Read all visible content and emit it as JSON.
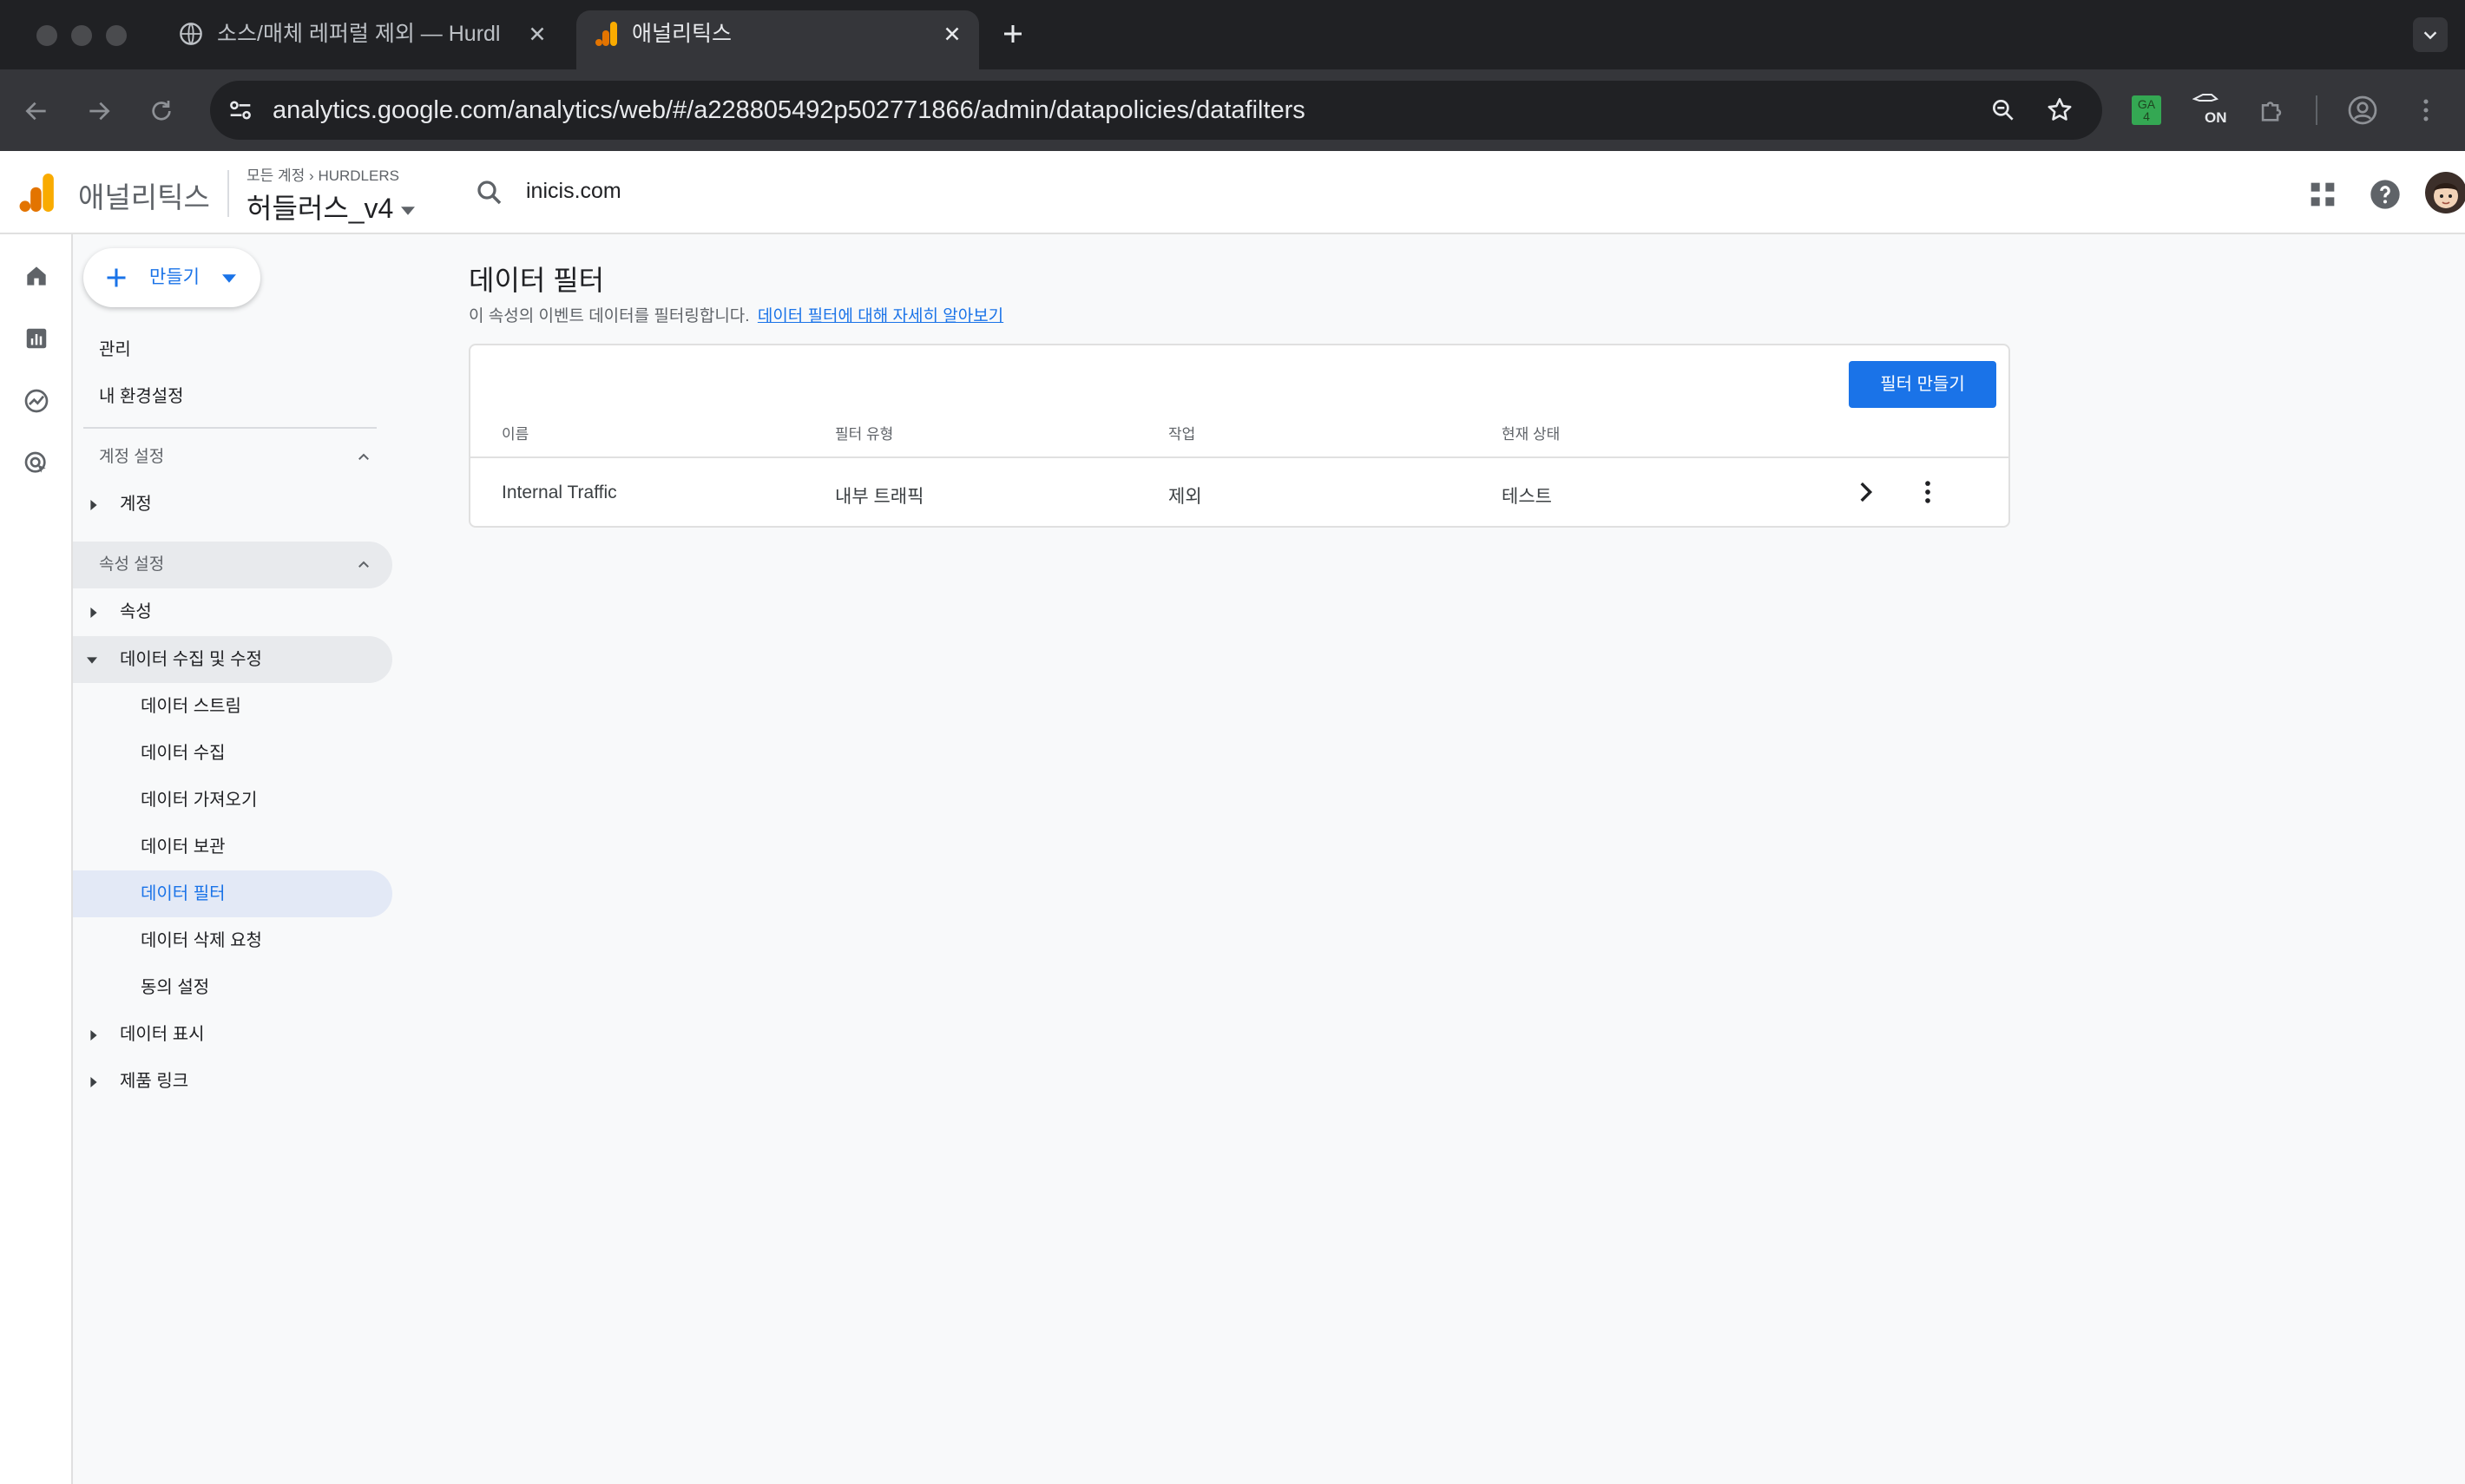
{
  "browser": {
    "tabs": [
      {
        "title": "소스/매체 레퍼럴 제외 — Hurdlers",
        "icon": "globe-icon",
        "active": false
      },
      {
        "title": "애널리틱스",
        "icon": "analytics-logo-icon",
        "active": true
      }
    ],
    "url": "analytics.google.com/analytics/web/#/a228805492p502771866/admin/datapolicies/datafilters",
    "extensions": [
      "ga4-extension-icon",
      "tag-assistant-on-icon",
      "puzzle-icon"
    ],
    "ga4_badge": "GA\n4",
    "on_badge": "ON"
  },
  "app": {
    "product_name": "애널리틱스",
    "breadcrumb_root": "모든 계정",
    "breadcrumb_account": "HURDLERS",
    "property_name": "허들러스_v4",
    "search_value": "inicis.com"
  },
  "sidebar": {
    "create_label": "만들기",
    "admin_label": "관리",
    "preferences_label": "내 환경설정",
    "account_section": "계정 설정",
    "account_item": "계정",
    "property_section": "속성 설정",
    "property_item": "속성",
    "data_collection_group": "데이터 수집 및 수정",
    "data_collection_items": [
      "데이터 스트림",
      "데이터 수집",
      "데이터 가져오기",
      "데이터 보관",
      "데이터 필터",
      "데이터 삭제 요청",
      "동의 설정"
    ],
    "active_item": "데이터 필터",
    "data_display": "데이터 표시",
    "product_links": "제품 링크"
  },
  "page": {
    "title": "데이터 필터",
    "description": "이 속성의 이벤트 데이터를 필터링합니다.",
    "learn_more": "데이터 필터에 대해 자세히 알아보기",
    "create_button": "필터 만들기"
  },
  "table": {
    "columns": [
      "이름",
      "필터 유형",
      "작업",
      "현재 상태"
    ],
    "rows": [
      {
        "name": "Internal Traffic",
        "type": "내부 트래픽",
        "operation": "제외",
        "status": "테스트"
      }
    ]
  },
  "colors": {
    "accent": "#1a73e8",
    "logo_orange": "#f9ab00",
    "logo_dark_orange": "#e37400",
    "chrome_dark": "#202124",
    "chrome_toolbar": "#35363a"
  }
}
